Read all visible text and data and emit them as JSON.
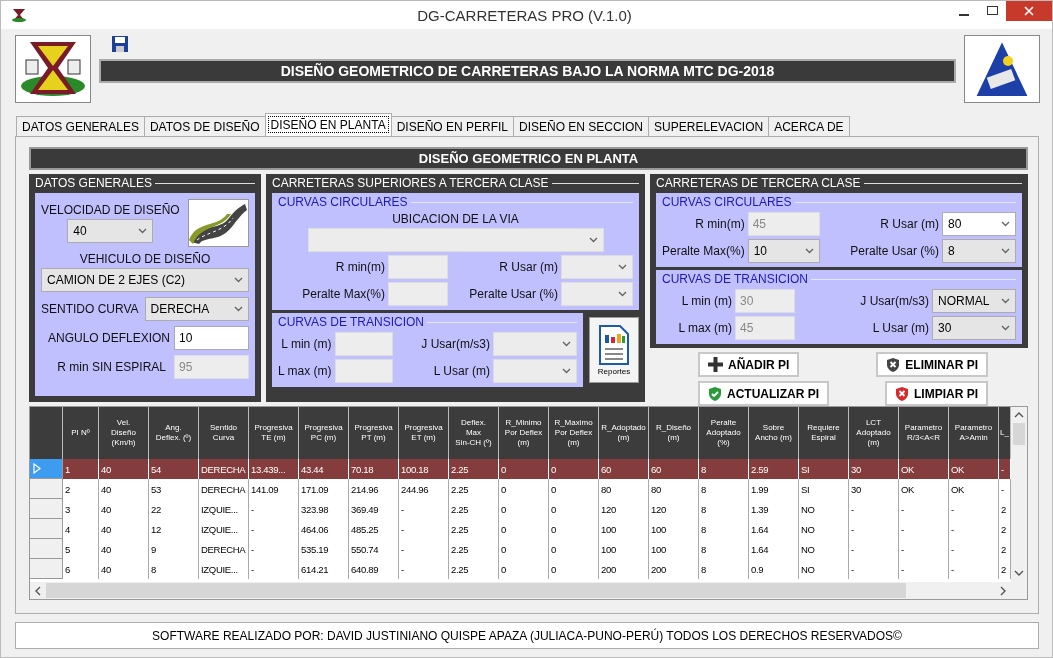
{
  "window": {
    "title": "DG-CARRETERAS PRO (V.1.0)"
  },
  "banner": "DISEÑO GEOMETRICO DE CARRETERAS BAJO LA NORMA MTC DG-2018",
  "tabs": [
    {
      "label": "DATOS GENERALES",
      "selected": false
    },
    {
      "label": "DATOS DE DISEÑO",
      "selected": false
    },
    {
      "label": "DISEÑO EN PLANTA",
      "selected": true
    },
    {
      "label": "DISEÑO EN PERFIL",
      "selected": false
    },
    {
      "label": "DISEÑO EN SECCION",
      "selected": false
    },
    {
      "label": "SUPERELEVACION",
      "selected": false
    },
    {
      "label": "ACERCA DE",
      "selected": false
    }
  ],
  "panel_title": "DISEÑO GEOMETRICO EN PLANTA",
  "datos_generales": {
    "title": "DATOS GENERALES",
    "fields": [
      {
        "label": "VELOCIDAD DE DISEÑO",
        "kind": "dropdown",
        "value": "40",
        "disabled": false
      },
      {
        "label": "VEHICULO DE DISEÑO",
        "kind": "dropdown",
        "value": "CAMION DE 2 EJES (C2)",
        "disabled": false
      },
      {
        "label": "SENTIDO CURVA",
        "kind": "dropdown",
        "value": "DERECHA",
        "disabled": false
      },
      {
        "label": "ANGULO DEFLEXION",
        "kind": "text",
        "value": "10",
        "disabled": false
      },
      {
        "label": "R min SIN ESPIRAL",
        "kind": "text",
        "value": "95",
        "disabled": true
      }
    ]
  },
  "superiores": {
    "title": "CARRETERAS SUPERIORES A TERCERA CLASE",
    "circulares": {
      "title": "CURVAS CIRCULARES",
      "fields": [
        {
          "label": "UBICACION DE LA VIA",
          "kind": "dropdown",
          "disabled": true
        },
        {
          "label": "R min(m)",
          "kind": "text",
          "disabled": true
        },
        {
          "label": "R Usar (m)",
          "kind": "combo",
          "disabled": true
        },
        {
          "label": "Peralte Max(%)",
          "kind": "text",
          "disabled": true
        },
        {
          "label": "Peralte Usar (%)",
          "kind": "dropdown",
          "disabled": true
        }
      ]
    },
    "transicion": {
      "title": "CURVAS DE TRANSICION",
      "fields": [
        {
          "label": "L min (m)",
          "kind": "text",
          "disabled": true
        },
        {
          "label": "J Usar(m/s3)",
          "kind": "dropdown",
          "disabled": true
        },
        {
          "label": "L max (m)",
          "kind": "text",
          "disabled": true
        },
        {
          "label": "L Usar (m)",
          "kind": "dropdown",
          "disabled": true
        }
      ]
    },
    "reportes_button": "Reportes"
  },
  "tercera": {
    "title": "CARRETERAS DE TERCERA CLASE",
    "circulares": {
      "title": "CURVAS CIRCULARES",
      "fields": [
        {
          "label": "R min(m)",
          "kind": "text",
          "value": "45",
          "disabled": true
        },
        {
          "label": "R Usar (m)",
          "kind": "combo",
          "value": "80",
          "disabled": false
        },
        {
          "label": "Peralte Max(%)",
          "kind": "dropdown",
          "value": "10",
          "disabled": false
        },
        {
          "label": "Peralte Usar (%)",
          "kind": "dropdown",
          "value": "8",
          "disabled": false
        }
      ]
    },
    "transicion": {
      "title": "CURVAS DE TRANSICION",
      "fields": [
        {
          "label": "L min (m)",
          "kind": "text",
          "value": "30",
          "disabled": true
        },
        {
          "label": "J Usar(m/s3)",
          "kind": "dropdown",
          "value": "NORMAL",
          "disabled": false
        },
        {
          "label": "L max (m)",
          "kind": "text",
          "value": "45",
          "disabled": true
        },
        {
          "label": "L Usar (m)",
          "kind": "dropdown",
          "value": "30",
          "disabled": false
        }
      ]
    }
  },
  "buttons": [
    {
      "label": "AÑADIR PI",
      "kind": "add"
    },
    {
      "label": "ELIMINAR PI",
      "kind": "delete"
    },
    {
      "label": "ACTUALIZAR PI",
      "kind": "update"
    },
    {
      "label": "LIMPIAR PI",
      "kind": "clear"
    }
  ],
  "table": {
    "columns": [
      "PI Nº",
      "Vel.\nDiseño\n(Km/h)",
      "Ang.\nDeflex. (º)",
      "Sentido\nCurva",
      "Progresiva\nTE (m)",
      "Progresiva\nPC (m)",
      "Progresiva\nPT (m)",
      "Progresiva\nET (m)",
      "Deflex.\nMax\nSin-CH (º)",
      "R_Minimo\nPor Deflex\n(m)",
      "R_Maximo\nPor Deflex\n(m)",
      "R_Adoptado\n(m)",
      "R_Diseño\n(m)",
      "Peralte\nAdoptado\n(%)",
      "Sobre\nAncho (m)",
      "Requiere\nEspiral",
      "LCT\nAdoptado\n(m)",
      "Parametro\nR/3<A<R",
      "Parametro\nA>Amin",
      "L_"
    ],
    "rows": [
      {
        "selected": true,
        "cells": [
          "1",
          "40",
          "54",
          "DERECHA",
          "13.439...",
          "43.44",
          "70.18",
          "100.18",
          "2.25",
          "0",
          "0",
          "60",
          "60",
          "8",
          "2.59",
          "SI",
          "30",
          "OK",
          "OK",
          "-"
        ]
      },
      {
        "selected": false,
        "cells": [
          "2",
          "40",
          "53",
          "DERECHA",
          "141.09",
          "171.09",
          "214.96",
          "244.96",
          "2.25",
          "0",
          "0",
          "80",
          "80",
          "8",
          "1.99",
          "SI",
          "30",
          "OK",
          "OK",
          "-"
        ]
      },
      {
        "selected": false,
        "cells": [
          "3",
          "40",
          "22",
          "IZQUIE...",
          "-",
          "323.98",
          "369.49",
          "-",
          "2.25",
          "0",
          "0",
          "120",
          "120",
          "8",
          "1.39",
          "NO",
          "-",
          "-",
          "-",
          "2"
        ]
      },
      {
        "selected": false,
        "cells": [
          "4",
          "40",
          "12",
          "IZQUIE...",
          "-",
          "464.06",
          "485.25",
          "-",
          "2.25",
          "0",
          "0",
          "100",
          "100",
          "8",
          "1.64",
          "NO",
          "-",
          "-",
          "-",
          "2"
        ]
      },
      {
        "selected": false,
        "cells": [
          "5",
          "40",
          "9",
          "DERECHA",
          "-",
          "535.19",
          "550.74",
          "-",
          "2.25",
          "0",
          "0",
          "100",
          "100",
          "8",
          "1.64",
          "NO",
          "-",
          "-",
          "-",
          "2"
        ]
      },
      {
        "selected": false,
        "cells": [
          "6",
          "40",
          "8",
          "IZQUIE...",
          "-",
          "614.21",
          "640.89",
          "-",
          "2.25",
          "0",
          "0",
          "200",
          "200",
          "8",
          "0.9",
          "NO",
          "-",
          "-",
          "-",
          "2"
        ]
      }
    ]
  },
  "footer": "SOFTWARE REALIZADO POR: DAVID JUSTINIANO QUISPE APAZA (JULIACA-PUNO-PERÚ) TODOS LOS DERECHOS RESERVADOS©"
}
